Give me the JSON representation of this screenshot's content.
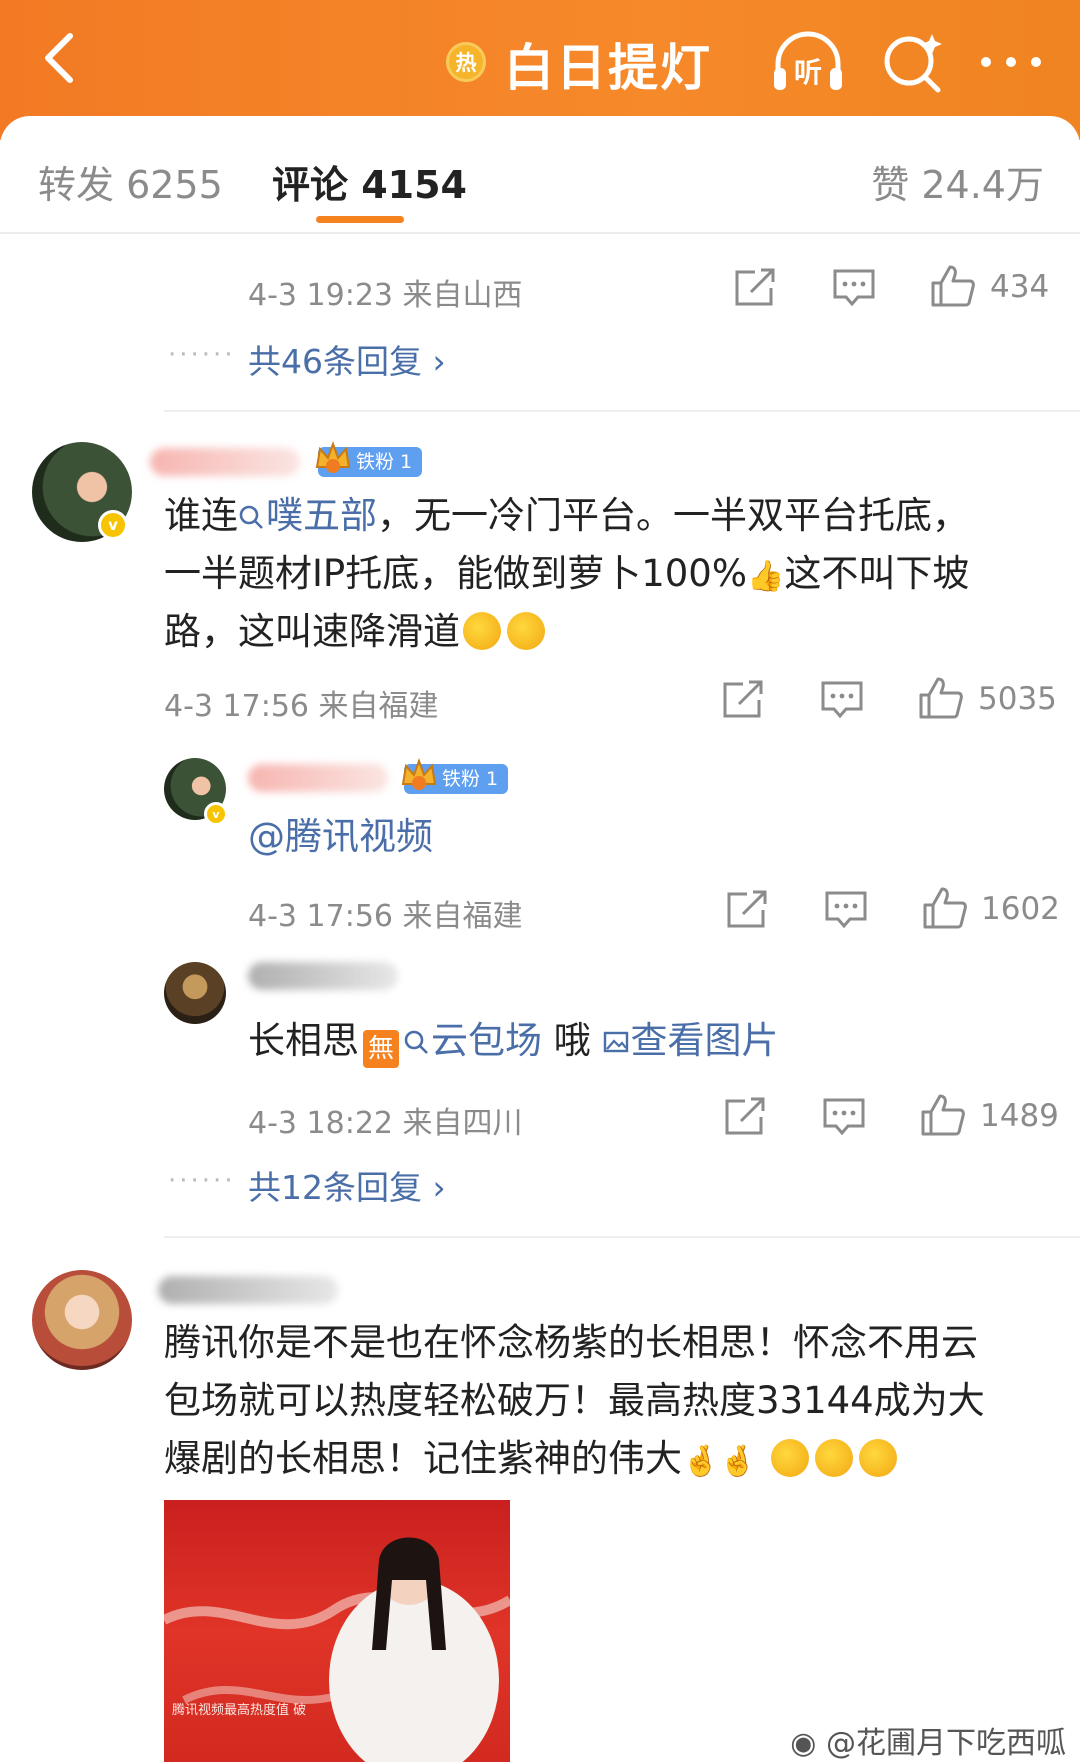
{
  "header": {
    "hot_label": "热",
    "title": "白日提灯",
    "listen_label": "听",
    "bg_color": "#f27a24"
  },
  "tabs": {
    "repost": "转发 6255",
    "comment": "评论 4154",
    "like": "赞 24.4万"
  },
  "prev_comment": {
    "meta": "4-3 19:23  来自山西",
    "like_count": "434",
    "replies": "共46条回复"
  },
  "comment1": {
    "fan_badge": "铁粉 1",
    "text_a": "谁连",
    "topic": "噗五部",
    "text_b": "，无一冷门平台。一半双平台托底，",
    "line2": "一半题材IP托底，能做到萝卜100%",
    "line2_b": "这不叫下坡",
    "line3": "路，这叫速降滑道",
    "meta": "4-3 17:56  来自福建",
    "like_count": "5035"
  },
  "reply1": {
    "fan_badge": "铁粉 1",
    "text": "@腾讯视频",
    "meta": "4-3 17:56  来自福建",
    "like_count": "1602"
  },
  "reply2": {
    "text_a": "长相思",
    "wu": "無",
    "topic": "云包场",
    "text_b": " 哦 ",
    "image_link": "查看图片",
    "meta": "4-3 18:22  来自四川",
    "like_count": "1489",
    "replies": "共12条回复"
  },
  "comment2": {
    "line1": "腾讯你是不是也在怀念杨紫的长相思！怀念不用云",
    "line2": "包场就可以热度轻松破万！最高热度33144成为大",
    "line3": "爆剧的长相思！记住紫神的伟大",
    "photo_caption": "腾讯视频最高热度值 破"
  },
  "watermark": "@花圃月下吃西呱",
  "colors": {
    "accent": "#f5821f",
    "link": "#4a6ea8",
    "fan_badge": "#5e9ff0"
  }
}
